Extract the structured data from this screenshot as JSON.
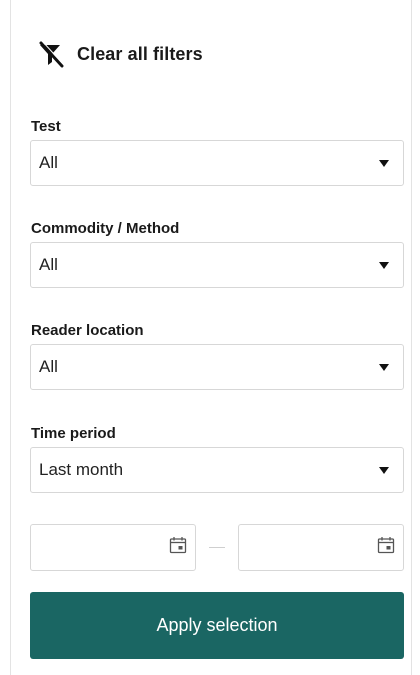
{
  "clear_filters": {
    "label": "Clear all filters",
    "icon": "filter-clear-icon"
  },
  "filters": [
    {
      "label": "Test",
      "value": "All"
    },
    {
      "label": "Commodity / Method",
      "value": "All"
    },
    {
      "label": "Reader location",
      "value": "All"
    },
    {
      "label": "Time period",
      "value": "Last month"
    }
  ],
  "date_range": {
    "start_value": "",
    "end_value": "",
    "icon": "calendar-icon"
  },
  "apply_button": {
    "label": "Apply selection"
  },
  "colors": {
    "accent": "#1a6663",
    "border": "#d7d7d7",
    "text": "#1a1a1a"
  }
}
